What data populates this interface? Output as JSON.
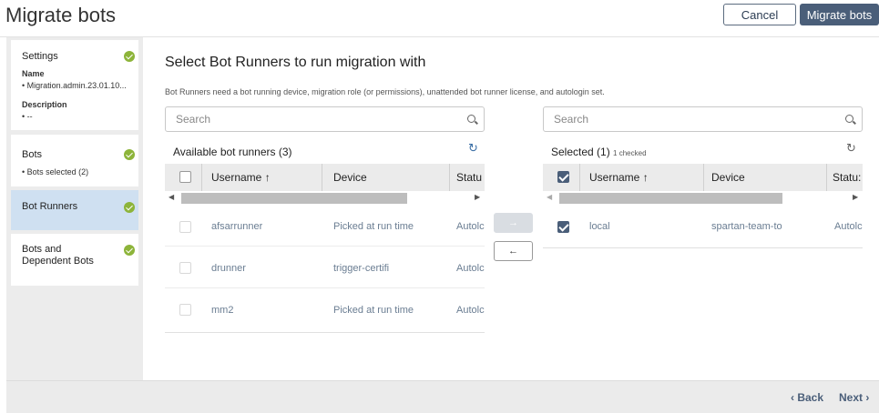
{
  "header": {
    "title": "Migrate bots",
    "cancel_label": "Cancel",
    "migrate_label": "Migrate bots"
  },
  "sidebar": {
    "steps": [
      {
        "title": "Settings",
        "sub1_label": "Name",
        "sub1_value": "• Migration.admin.23.01.10...",
        "sub2_label": "Description",
        "sub2_value": "• --"
      },
      {
        "title": "Bots",
        "sub1_value": "• Bots selected (2)"
      },
      {
        "title": "Bot Runners"
      },
      {
        "title": "Bots and Dependent Bots"
      }
    ]
  },
  "main": {
    "title": "Select Bot Runners to run migration with",
    "description": "Bot Runners need a bot running device, migration role (or permissions), unattended bot runner license, and autologin set."
  },
  "available": {
    "search_placeholder": "Search",
    "label": "Available bot runners (3)",
    "columns": [
      "Username ↑",
      "Device",
      "Statu"
    ],
    "rows": [
      {
        "username": "afsarrunner",
        "device": "Picked at run time",
        "status": "Autolc"
      },
      {
        "username": "drunner",
        "device": "trigger-certifi",
        "status": "Autolc"
      },
      {
        "username": "mm2",
        "device": "Picked at run time",
        "status": "Autolc"
      }
    ]
  },
  "selected": {
    "search_placeholder": "Search",
    "label": "Selected (1)",
    "checked_note": "1 checked",
    "columns": [
      "Username ↑",
      "Device",
      "Statu:"
    ],
    "rows": [
      {
        "username": "local",
        "device": "spartan-team-to",
        "status": "Autolc"
      }
    ]
  },
  "move": {
    "right": "→",
    "left": "←"
  },
  "footer": {
    "back_label": "‹ Back",
    "next_label": "Next ›"
  },
  "icons": {
    "refresh": "↻",
    "check": "check-circle-icon",
    "search": "search-icon"
  },
  "colors": {
    "primary": "#4a5e79",
    "success": "#8db43a",
    "active_step": "#cfe0f1"
  }
}
